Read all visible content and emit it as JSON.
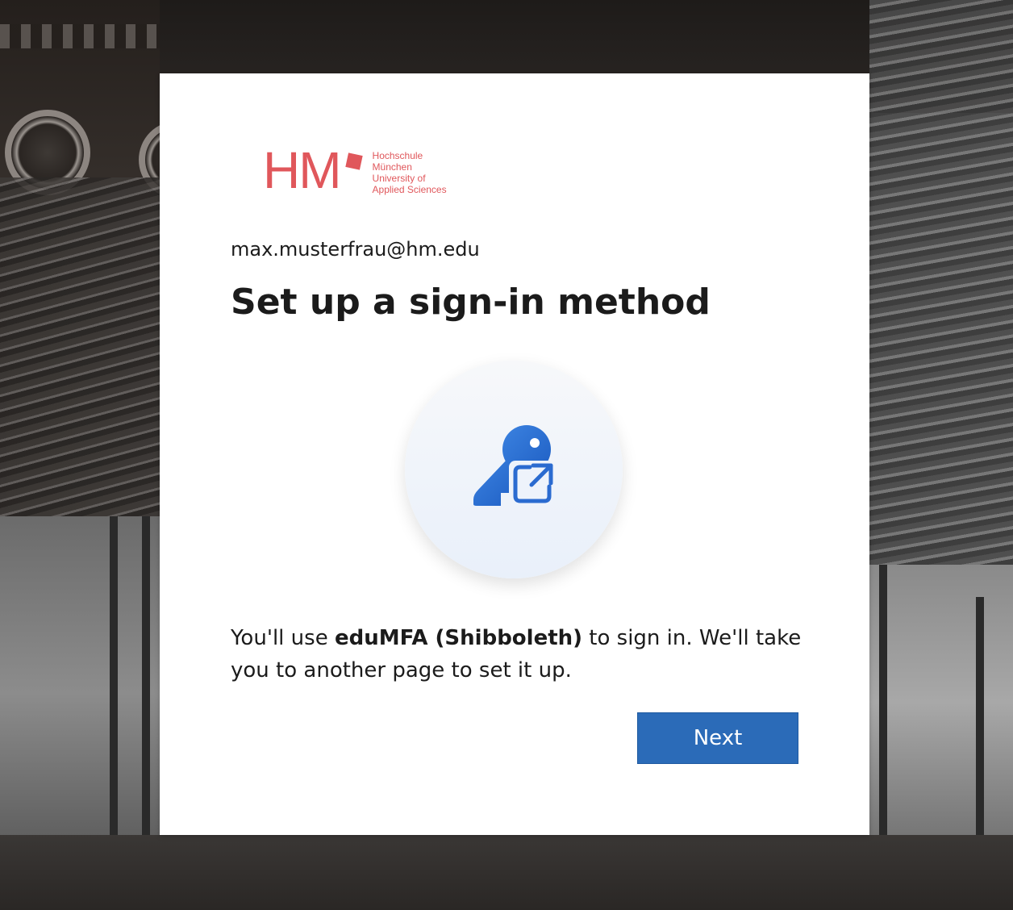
{
  "logo": {
    "mark": "HM",
    "lines": [
      "Hochschule",
      "München",
      "University of",
      "Applied Sciences"
    ],
    "color": "#e0575b"
  },
  "account": {
    "email": "max.musterfrau@hm.edu"
  },
  "main": {
    "title": "Set up a sign-in method",
    "icon": "key-external-link-icon",
    "description_prefix": "You'll use ",
    "description_method": "eduMFA (Shibboleth)",
    "description_suffix": " to sign in. We'll take you to another page to set it up."
  },
  "actions": {
    "next_label": "Next",
    "accent": "#2b6bb8"
  }
}
